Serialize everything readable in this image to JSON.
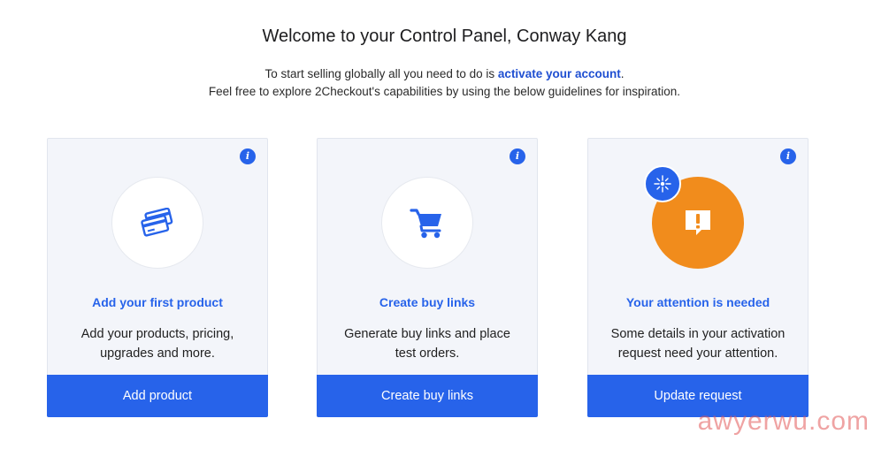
{
  "header": {
    "title": "Welcome to your Control Panel, Conway Kang",
    "intro_prefix": "To start selling globally all you need to do is ",
    "intro_link": "activate your account",
    "intro_suffix": ".",
    "intro_line2": "Feel free to explore 2Checkout's capabilities by using the below guidelines for inspiration."
  },
  "cards": [
    {
      "icon": "credit-cards-icon",
      "title": "Add your first product",
      "description": "Add your products, pricing, upgrades and more.",
      "button": "Add product"
    },
    {
      "icon": "shopping-cart-icon",
      "title": "Create buy links",
      "description": "Generate buy links and place test orders.",
      "button": "Create buy links"
    },
    {
      "icon": "alert-message-icon",
      "title": "Your attention is needed",
      "description": "Some details in your activation request need your attention.",
      "button": "Update request"
    }
  ],
  "info_glyph": "i",
  "colors": {
    "accent": "#2763ea",
    "warning": "#f18c1c",
    "card_bg": "#f3f5fa"
  },
  "watermark": "awyerwu.com"
}
